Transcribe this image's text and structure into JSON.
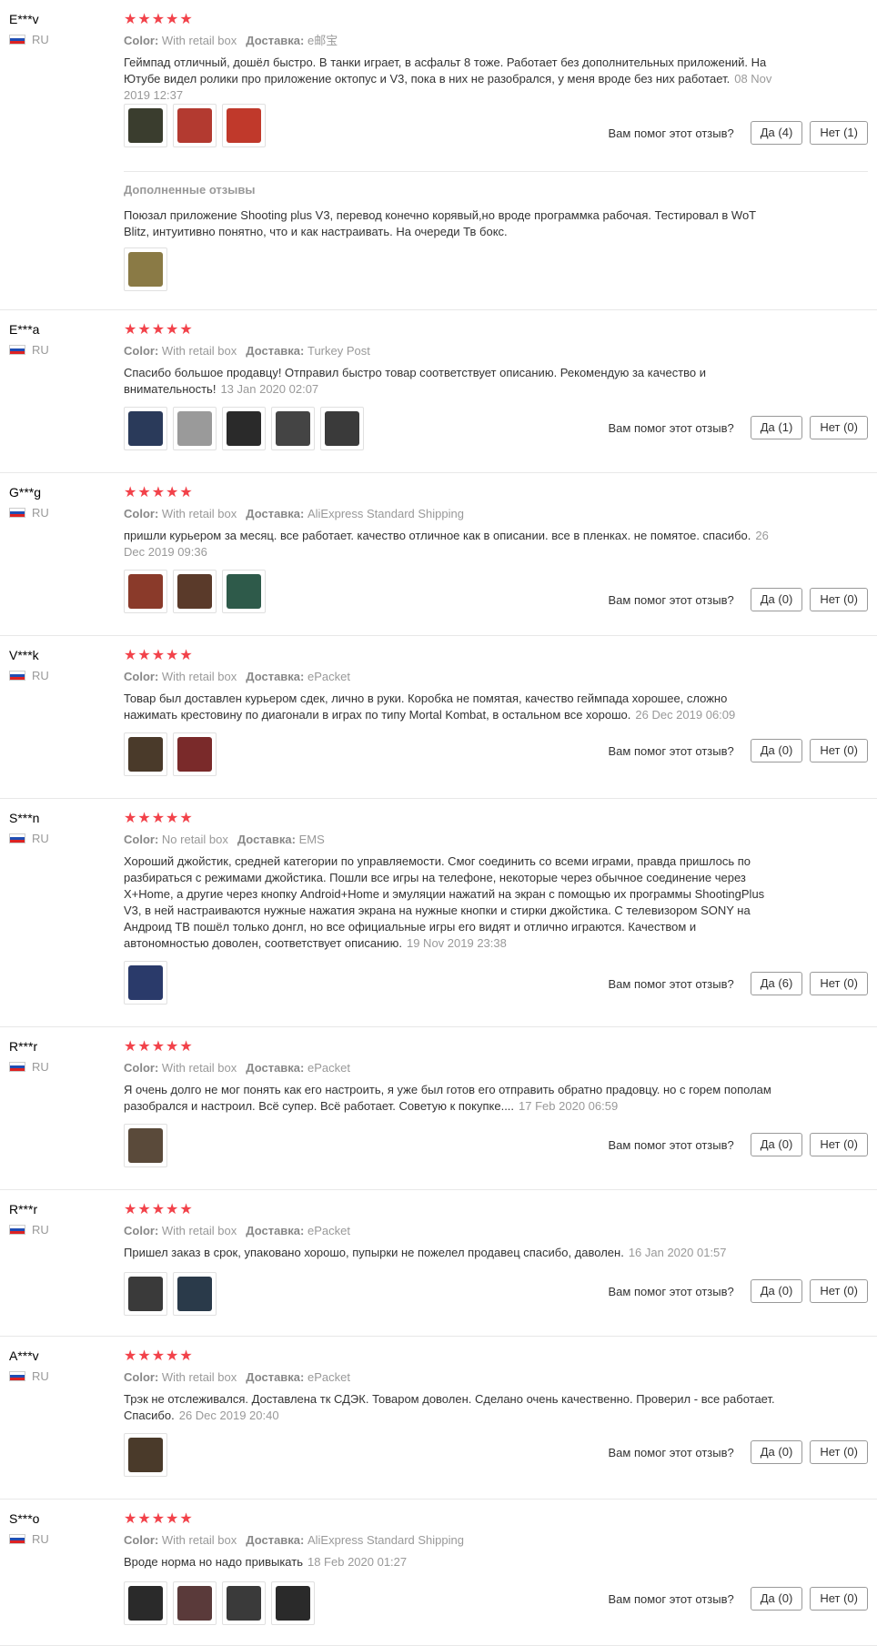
{
  "labels": {
    "color": "Color:",
    "shipping": "Доставка:",
    "helpful_question": "Вам помог этот отзыв?",
    "yes": "Да",
    "no": "Нет",
    "additional_title": "Дополненные отзывы"
  },
  "reviews": [
    {
      "user": "E***v",
      "country": "RU",
      "stars": 5,
      "color": "With retail box",
      "shipping": "e邮宝",
      "text": "Геймпад отличный, дошёл быстро. В танки играет, в асфальт 8 тоже. Работает без дополнительных приложений. На Ютубе видел ролики про приложение октопус и V3, пока в них не разобрался, у меня вроде без них работает.",
      "date": "08 Nov 2019 12:37",
      "thumbs": [
        "#3a3d2e",
        "#b33a30",
        "#c0392b"
      ],
      "yes": 4,
      "no": 1,
      "additional": {
        "text": "Поюзал приложение Shooting plus V3, перевод конечно корявый,но вроде программка рабочая. Тестировал в WoT Blitz, интуитивно понятно, что и как настраивать. На очереди Тв бокс.",
        "thumbs": [
          "#8a7a45"
        ]
      }
    },
    {
      "user": "E***a",
      "country": "RU",
      "stars": 5,
      "color": "With retail box",
      "shipping": "Turkey Post",
      "text": "Спасибо большое продавцу! Отправил быстро товар соответствует описанию. Рекомендую за качество и внимательность!",
      "date": "13 Jan 2020 02:07",
      "thumbs": [
        "#2a3a5a",
        "#9a9a9a",
        "#2a2a2a",
        "#444444",
        "#3a3a3a"
      ],
      "yes": 1,
      "no": 0
    },
    {
      "user": "G***g",
      "country": "RU",
      "stars": 5,
      "color": "With retail box",
      "shipping": "AliExpress Standard Shipping",
      "text": "пришли курьером за месяц. все работает. качество отличное как в описании. все в пленках. не помятое. спасибо.",
      "date": "26 Dec 2019 09:36",
      "thumbs": [
        "#8a3a2a",
        "#5a3a2a",
        "#2e5a4a"
      ],
      "yes": 0,
      "no": 0
    },
    {
      "user": "V***k",
      "country": "RU",
      "stars": 5,
      "color": "With retail box",
      "shipping": "ePacket",
      "text": "Товар был доставлен курьером сдек, лично в руки. Коробка не помятая, качество геймпада хорошее, сложно нажимать крестовину по диагонали в играх по типу Mortal Kombat, в остальном все хорошо.",
      "date": "26 Dec 2019 06:09",
      "thumbs": [
        "#4a3a2a",
        "#7a2a2a"
      ],
      "yes": 0,
      "no": 0
    },
    {
      "user": "S***n",
      "country": "RU",
      "stars": 5,
      "color": "No retail box",
      "shipping": "EMS",
      "text": "Хороший джойстик, средней категории по управляемости. Смог соединить со всеми играми, правда пришлось по разбираться с режимами джойстика. Пошли все игры на телефоне, некоторые через обычное соединение через X+Home, а другие через кнопку Android+Home и эмуляции нажатий на экран с помощью их программы ShootingPlus V3, в ней настраиваются нужные нажатия экрана на нужные кнопки и стирки джойстика. С телевизором SONY на Андроид ТВ пошёл только донгл, но все официальные игры его видят и отлично играются. Качеством и автономностью доволен, соответствует описанию.",
      "date": "19 Nov 2019 23:38",
      "thumbs": [
        "#2a3a6a"
      ],
      "yes": 6,
      "no": 0
    },
    {
      "user": "R***r",
      "country": "RU",
      "stars": 5,
      "color": "With retail box",
      "shipping": "ePacket",
      "text": "Я очень долго не мог понять как его настроить, я уже был готов его отправить обратно прадовцу. но с горем пополам разобрался и настроил. Всё супер. Всё работает. Советую к покупке....",
      "date": "17 Feb 2020 06:59",
      "thumbs": [
        "#5a4a3a"
      ],
      "yes": 0,
      "no": 0
    },
    {
      "user": "R***r",
      "country": "RU",
      "stars": 5,
      "color": "With retail box",
      "shipping": "ePacket",
      "text": "Пришел заказ в срок, упаковано хорошо, пупырки не пожелел продавец спасибо, даволен.",
      "date": "16 Jan 2020 01:57",
      "thumbs": [
        "#3a3a3a",
        "#2a3a4a"
      ],
      "yes": 0,
      "no": 0
    },
    {
      "user": "A***v",
      "country": "RU",
      "stars": 5,
      "color": "With retail box",
      "shipping": "ePacket",
      "text": "Трэк не отслеживался. Доставлена тк СДЭК. Товаром доволен. Сделано очень качественно. Проверил - все работает. Спасибо.",
      "date": "26 Dec 2019 20:40",
      "thumbs": [
        "#4a3a2a"
      ],
      "yes": 0,
      "no": 0
    },
    {
      "user": "S***o",
      "country": "RU",
      "stars": 5,
      "color": "With retail box",
      "shipping": "AliExpress Standard Shipping",
      "text": "Вроде норма но надо привыкать",
      "date": "18 Feb 2020 01:27",
      "thumbs": [
        "#2a2a2a",
        "#5a3a3a",
        "#3a3a3a",
        "#2a2a2a"
      ],
      "yes": 0,
      "no": 0
    }
  ]
}
